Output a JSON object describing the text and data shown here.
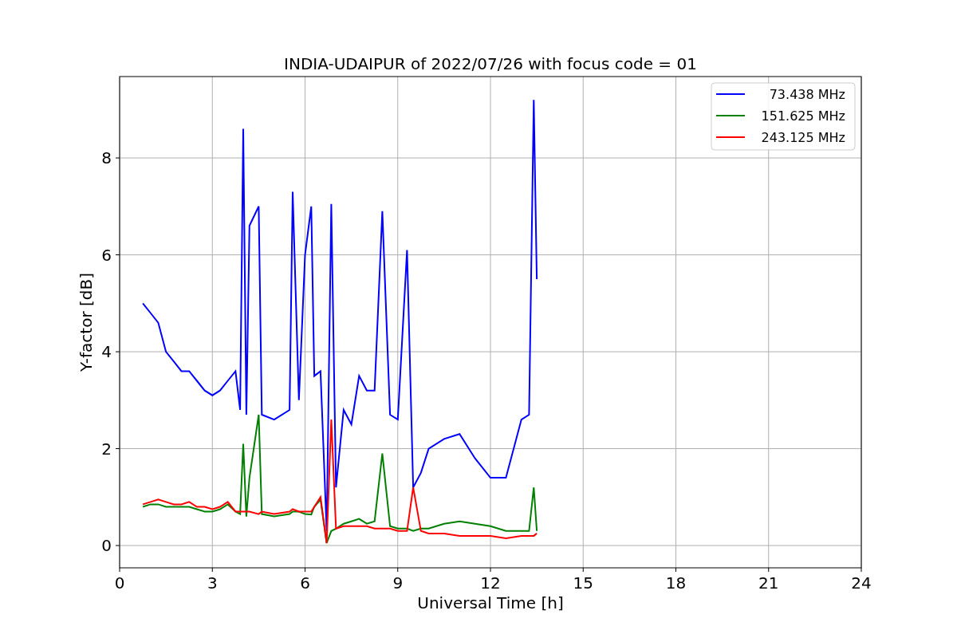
{
  "chart_data": {
    "type": "line",
    "title": "INDIA-UDAIPUR of 2022/07/26 with focus code = 01",
    "xlabel": "Universal Time [h]",
    "ylabel": "Y-factor [dB]",
    "x": [
      0.75,
      1.0,
      1.25,
      1.5,
      1.75,
      2.0,
      2.25,
      2.5,
      2.75,
      3.0,
      3.25,
      3.5,
      3.75,
      3.9,
      4.0,
      4.1,
      4.2,
      4.5,
      4.6,
      5.0,
      5.5,
      5.6,
      5.8,
      6.0,
      6.2,
      6.3,
      6.5,
      6.7,
      6.85,
      7.0,
      7.25,
      7.5,
      7.75,
      8.0,
      8.25,
      8.5,
      8.75,
      9.0,
      9.3,
      9.5,
      9.75,
      10.0,
      10.5,
      11.0,
      11.5,
      12.0,
      12.5,
      13.0,
      13.25,
      13.4,
      13.5
    ],
    "series": [
      {
        "name": "73.438 MHz",
        "color": "#0000ff",
        "values": [
          5.0,
          4.8,
          4.6,
          4.0,
          3.8,
          3.6,
          3.6,
          3.4,
          3.2,
          3.1,
          3.2,
          3.4,
          3.6,
          2.8,
          8.6,
          2.7,
          6.6,
          7.0,
          2.7,
          2.6,
          2.8,
          7.3,
          3.0,
          6.0,
          7.0,
          3.5,
          3.6,
          0.3,
          7.05,
          1.2,
          2.8,
          2.5,
          3.5,
          3.2,
          3.2,
          6.9,
          2.7,
          2.6,
          6.1,
          1.2,
          1.5,
          2.0,
          2.2,
          2.3,
          1.8,
          1.4,
          1.4,
          2.6,
          2.7,
          9.2,
          5.5
        ]
      },
      {
        "name": "151.625 MHz",
        "color": "#008000",
        "values": [
          0.8,
          0.85,
          0.85,
          0.8,
          0.8,
          0.8,
          0.8,
          0.75,
          0.7,
          0.7,
          0.75,
          0.85,
          0.7,
          0.65,
          2.1,
          0.6,
          1.4,
          2.7,
          0.65,
          0.6,
          0.65,
          0.7,
          0.7,
          0.65,
          0.64,
          0.8,
          0.95,
          0.05,
          0.3,
          0.35,
          0.45,
          0.5,
          0.55,
          0.45,
          0.5,
          1.9,
          0.4,
          0.35,
          0.35,
          0.3,
          0.35,
          0.35,
          0.45,
          0.5,
          0.45,
          0.4,
          0.3,
          0.3,
          0.3,
          1.2,
          0.3
        ]
      },
      {
        "name": "243.125 MHz",
        "color": "#ff0000",
        "values": [
          0.85,
          0.9,
          0.95,
          0.9,
          0.85,
          0.85,
          0.9,
          0.8,
          0.8,
          0.75,
          0.8,
          0.9,
          0.7,
          0.7,
          0.7,
          0.7,
          0.7,
          0.65,
          0.7,
          0.65,
          0.7,
          0.75,
          0.7,
          0.7,
          0.7,
          0.8,
          1.0,
          0.05,
          2.6,
          0.35,
          0.4,
          0.4,
          0.4,
          0.4,
          0.35,
          0.35,
          0.35,
          0.3,
          0.3,
          1.2,
          0.3,
          0.25,
          0.25,
          0.2,
          0.2,
          0.2,
          0.15,
          0.2,
          0.2,
          0.2,
          0.25
        ]
      }
    ],
    "xlim": [
      0,
      24
    ],
    "ylim": [
      -0.46,
      9.68
    ],
    "xticks": [
      0,
      3,
      6,
      9,
      12,
      15,
      18,
      21,
      24
    ],
    "yticks": [
      0,
      2,
      4,
      6,
      8
    ],
    "grid": true,
    "legend": true
  }
}
